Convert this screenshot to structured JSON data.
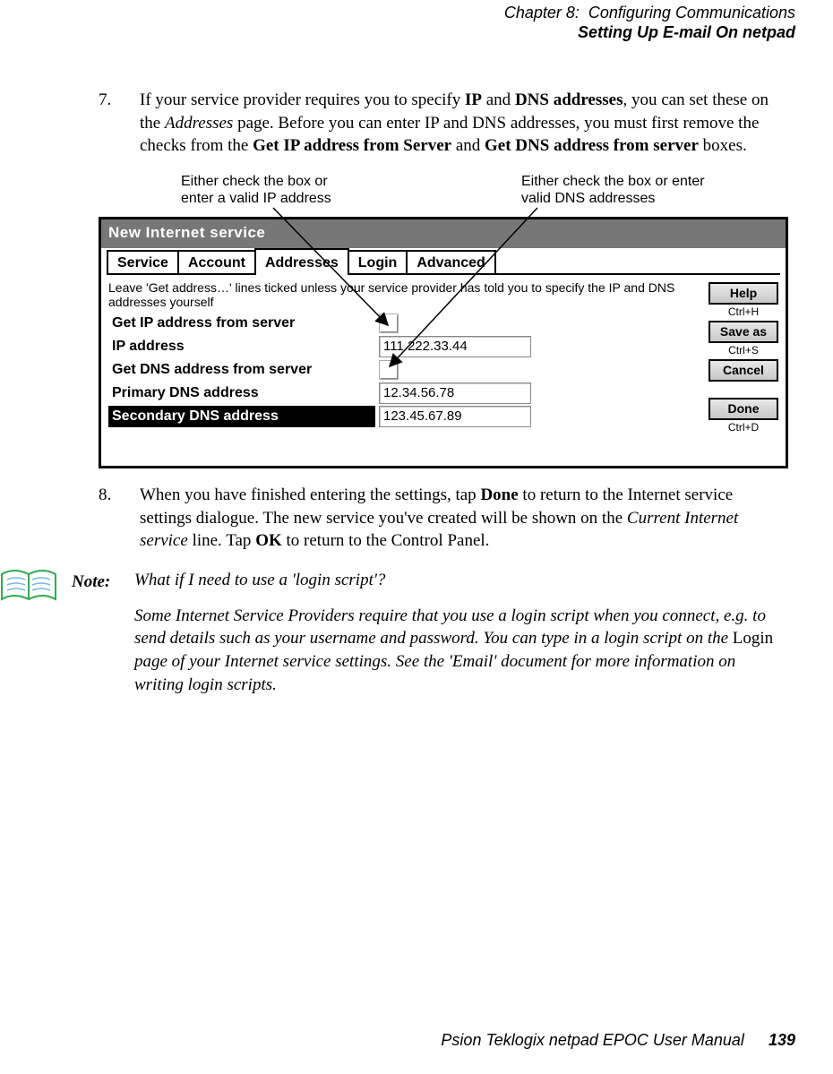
{
  "header": {
    "chapter": "Chapter 8:  Configuring Communications",
    "section": "Setting Up E-mail On netpad"
  },
  "step7": {
    "num": "7.",
    "t1": "If your service provider requires you to specify ",
    "b1": "IP",
    "t2": " and ",
    "b2": "DNS addresses",
    "t3": ", you can set these on the ",
    "i1": "Addresses",
    "t4": " page. Before you can enter IP and DNS addresses, you must first remove the checks from the ",
    "b3": "Get IP address from Server",
    "t5": " and ",
    "b4": "Get DNS address from server",
    "t6": " boxes."
  },
  "callouts": {
    "left": "Either check the box or enter a valid IP address",
    "right": "Either check the box or enter valid DNS addresses"
  },
  "dialog": {
    "title": "New Internet service",
    "tabs": [
      "Service",
      "Account",
      "Addresses",
      "Login",
      "Advanced"
    ],
    "hint": "Leave 'Get address…' lines ticked unless your service provider has told you to specify the IP and DNS addresses yourself",
    "rows": {
      "r1": "Get IP address from server",
      "r2": "IP address",
      "r2v": "111.222.33.44",
      "r3": "Get DNS address from server",
      "r4": "Primary DNS address",
      "r4v": "12.34.56.78",
      "r5": "Secondary DNS address",
      "r5v": "123.45.67.89"
    },
    "buttons": {
      "help": "Help",
      "help_s": "Ctrl+H",
      "saveas": "Save as",
      "saveas_s": "Ctrl+S",
      "cancel": "Cancel",
      "done": "Done",
      "done_s": "Ctrl+D"
    }
  },
  "step8": {
    "num": "8.",
    "t1": "When you have finished entering the settings, tap ",
    "b1": "Done",
    "t2": " to return to the Internet service settings dialogue. The new service you've created will be shown on the ",
    "i1": "Current Internet service",
    "t3": " line. Tap ",
    "b2": "OK",
    "t4": " to return to the Control Panel."
  },
  "note": {
    "label": "Note:",
    "q": "What if I need to use a 'login script'?",
    "p1a": "Some Internet Service Providers require that you use a login script when you connect, e.g. to send details such as your username and password. You can type in a login script on the ",
    "p1r": "Login",
    "p1b": " page of your Internet service settings. See the 'Email' document for more information on writing login scripts."
  },
  "footer": {
    "text": "Psion Teklogix netpad EPOC User Manual",
    "page": "139"
  }
}
